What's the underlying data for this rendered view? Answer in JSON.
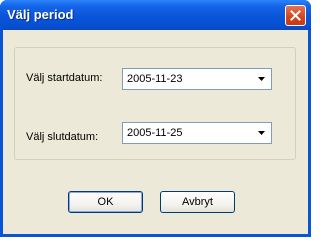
{
  "window": {
    "title": "Välj period"
  },
  "form": {
    "start_label": "Välj startdatum:",
    "start_value": "2005-11-23",
    "end_label": "Välj slutdatum:",
    "end_value": "2005-11-25"
  },
  "buttons": {
    "ok": "OK",
    "cancel": "Avbryt"
  },
  "icons": {
    "close": "close-icon",
    "dropdown": "chevron-down-icon"
  },
  "colors": {
    "titlebar": "#0a55da",
    "close_button": "#d2451f",
    "dialog_background": "#ece9d8"
  }
}
